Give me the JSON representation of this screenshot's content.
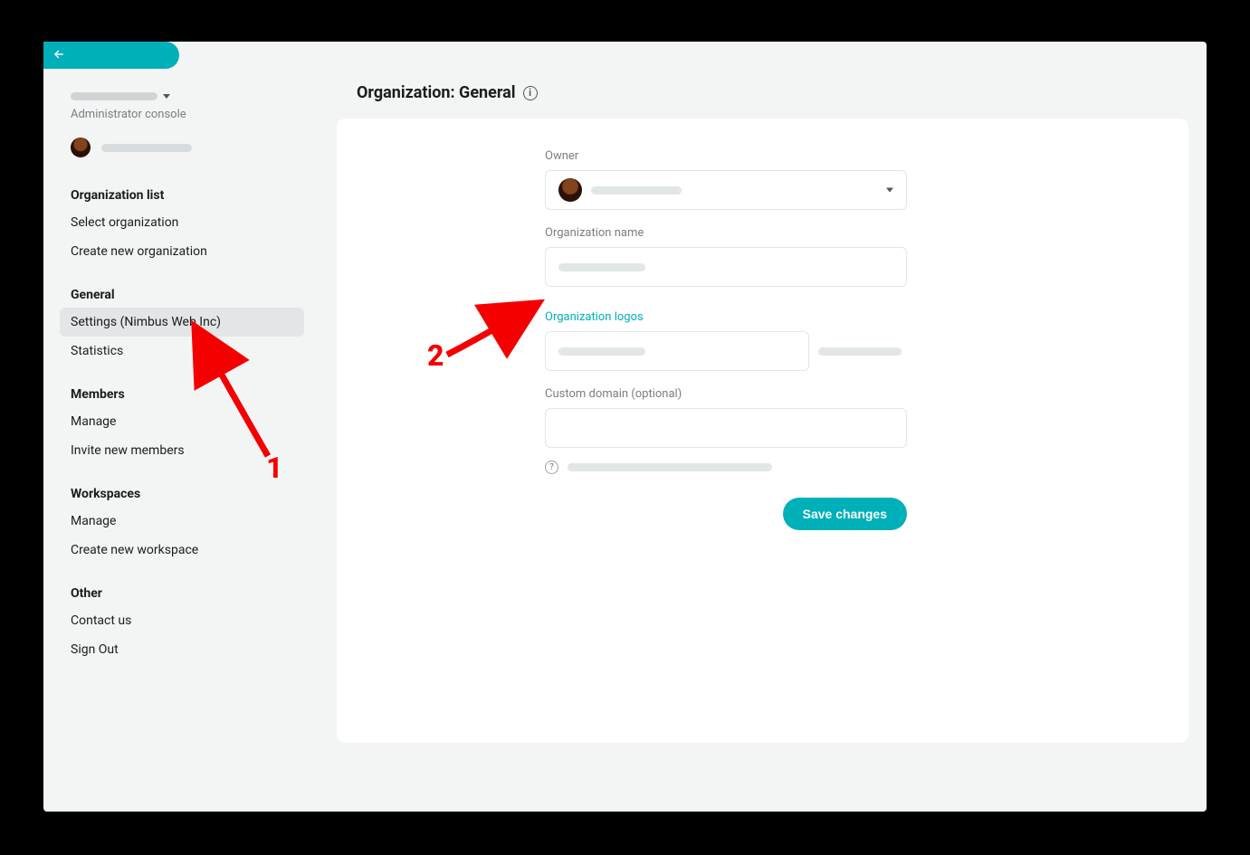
{
  "back_tab": {
    "icon_name": "arrow-left-icon"
  },
  "sidebar": {
    "admin_label": "Administrator console",
    "sections": [
      {
        "title": "Organization list",
        "items": [
          "Select organization",
          "Create new organization"
        ]
      },
      {
        "title": "General",
        "items": [
          "Settings (Nimbus Web Inc)",
          "Statistics"
        ],
        "active_index": 0
      },
      {
        "title": "Members",
        "items": [
          "Manage",
          "Invite new members"
        ]
      },
      {
        "title": "Workspaces",
        "items": [
          "Manage",
          "Create new workspace"
        ]
      },
      {
        "title": "Other",
        "items": [
          "Contact us",
          "Sign Out"
        ]
      }
    ]
  },
  "page": {
    "title": "Organization: General"
  },
  "form": {
    "owner_label": "Owner",
    "org_name_label": "Organization name",
    "org_logos_label": "Organization logos",
    "custom_domain_label": "Custom domain (optional)",
    "save_button": "Save changes"
  },
  "annotations": {
    "num1": "1",
    "num2": "2"
  },
  "colors": {
    "accent": "#00B0B9",
    "text": "#1c1c1c",
    "muted": "#7a7e80",
    "border": "#e2e6e6",
    "annotation_red": "#f40000"
  }
}
